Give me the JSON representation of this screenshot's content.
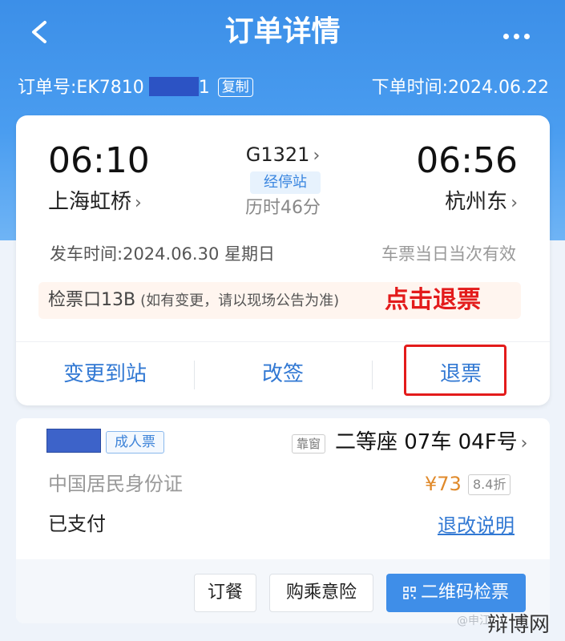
{
  "header": {
    "title": "订单详情",
    "order_no_label": "订单号:",
    "order_no_prefix": "EK7810",
    "order_no_suffix": "1",
    "copy_label": "复制",
    "order_time_label": "下单时间:",
    "order_time": "2024.06.22"
  },
  "trip": {
    "depart_time": "06:10",
    "arrive_time": "06:56",
    "depart_station": "上海虹桥",
    "arrive_station": "杭州东",
    "train_no": "G1321",
    "stops_badge": "经停站",
    "duration": "历时46分",
    "depart_date_label": "发车时间:",
    "depart_date": "2024.06.30 星期日",
    "validity": "车票当日当次有效",
    "gate": "检票口13B",
    "gate_note": "(如有变更，请以现场公告为准)",
    "annotation": "点击退票"
  },
  "actions": {
    "change_station": "变更到站",
    "reschedule": "改签",
    "refund": "退票"
  },
  "passenger": {
    "ticket_type": "成人票",
    "window_tag": "靠窗",
    "seat": "二等座 07车 04F号",
    "id_type": "中国居民身份证",
    "price": "¥73",
    "discount": "8.4折",
    "payment_status": "已支付",
    "refund_rules": "退改说明"
  },
  "bottom_buttons": {
    "meal": "订餐",
    "insurance": "购乘意险",
    "qr_check": "二维码检票"
  },
  "watermark": {
    "source": "@申江",
    "brand": "辩博网"
  },
  "colors": {
    "header_blue": "#3c8fe8",
    "link_blue": "#3178d3",
    "price_orange": "#e08a2b",
    "annotation_red": "#e31b1b"
  }
}
